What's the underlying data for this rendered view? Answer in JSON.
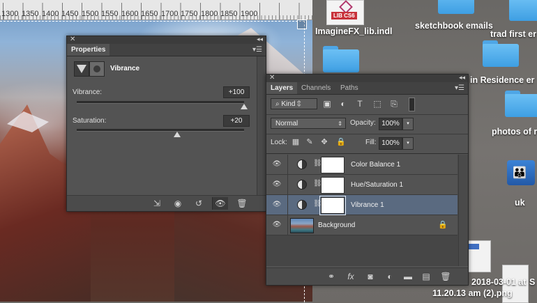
{
  "ruler": {
    "ticks": [
      "1300",
      "1350",
      "1400",
      "1450",
      "1500",
      "1550",
      "1600",
      "1650",
      "1700",
      "1750",
      "1800",
      "1850",
      "1900"
    ]
  },
  "desktop": {
    "items": [
      {
        "label": "ImagineFX_lib.indl",
        "icon": "lib-file-icon"
      },
      {
        "label": "sketchbook emails",
        "icon": "folder-icon"
      },
      {
        "label": "trad first er",
        "icon": "folder-icon"
      },
      {
        "label": "in Residence er",
        "icon": "folder-icon"
      },
      {
        "label": "photos of r",
        "icon": "folder-icon"
      },
      {
        "label": "uk",
        "icon": "network-drive-icon"
      },
      {
        "label": "2018-03-01 at",
        "icon": "png-file-icon"
      },
      {
        "label": "S",
        "icon": "document-icon"
      },
      {
        "label": "11.20.13 am (2).png",
        "icon": "png-file-icon"
      }
    ],
    "lib_badge": "LIB CS6"
  },
  "properties": {
    "tab": "Properties",
    "adjustment_name": "Vibrance",
    "vibrance": {
      "label": "Vibrance:",
      "value": "+100",
      "level": 1.0
    },
    "saturation": {
      "label": "Saturation:",
      "value": "+20",
      "level": 0.6
    }
  },
  "layers": {
    "tabs": [
      "Layers",
      "Channels",
      "Paths"
    ],
    "filter_kind": "Kind",
    "blend_mode": "Normal",
    "opacity_label": "Opacity:",
    "opacity_value": "100%",
    "lock_label": "Lock:",
    "fill_label": "Fill:",
    "fill_value": "100%",
    "rows": [
      {
        "name": "Color Balance 1",
        "type": "adjustment",
        "selected": false
      },
      {
        "name": "Hue/Saturation 1",
        "type": "adjustment",
        "selected": false
      },
      {
        "name": "Vibrance 1",
        "type": "adjustment",
        "selected": true
      },
      {
        "name": "Background",
        "type": "pixel",
        "selected": false,
        "locked": true
      }
    ],
    "footer_icons": [
      "link-icon",
      "fx-icon",
      "mask-icon",
      "adjustment-icon",
      "group-icon",
      "new-layer-icon",
      "trash-icon"
    ],
    "fx_label": "fx"
  }
}
